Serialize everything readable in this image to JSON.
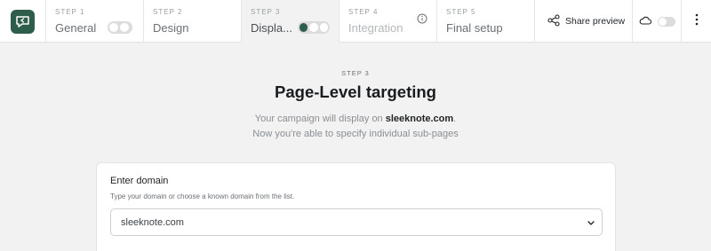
{
  "header": {
    "steps": [
      {
        "num": "STEP 1",
        "name": "General"
      },
      {
        "num": "STEP 2",
        "name": "Design"
      },
      {
        "num": "STEP 3",
        "name": "Displa..."
      },
      {
        "num": "STEP 4",
        "name": "Integration"
      },
      {
        "num": "STEP 5",
        "name": "Final setup"
      }
    ],
    "share_label": "Share preview"
  },
  "main": {
    "eyebrow": "STEP 3",
    "title": "Page-Level targeting",
    "sub_line1_prefix": "Your campaign will display on ",
    "sub_line1_domain": "sleeknote.com",
    "sub_line1_suffix": ".",
    "sub_line2": "Now you're able to specify individual sub-pages"
  },
  "domain_card": {
    "title": "Enter domain",
    "help": "Type your domain or choose a known domain from the list.",
    "selected_value": "sleeknote.com"
  },
  "colors": {
    "brand": "#2e5d4b",
    "page_bg": "#f2f2f2"
  },
  "icons": [
    "logo-icon",
    "info-icon",
    "share-icon",
    "cloud-icon",
    "more-vertical-icon",
    "chevron-down-icon"
  ]
}
